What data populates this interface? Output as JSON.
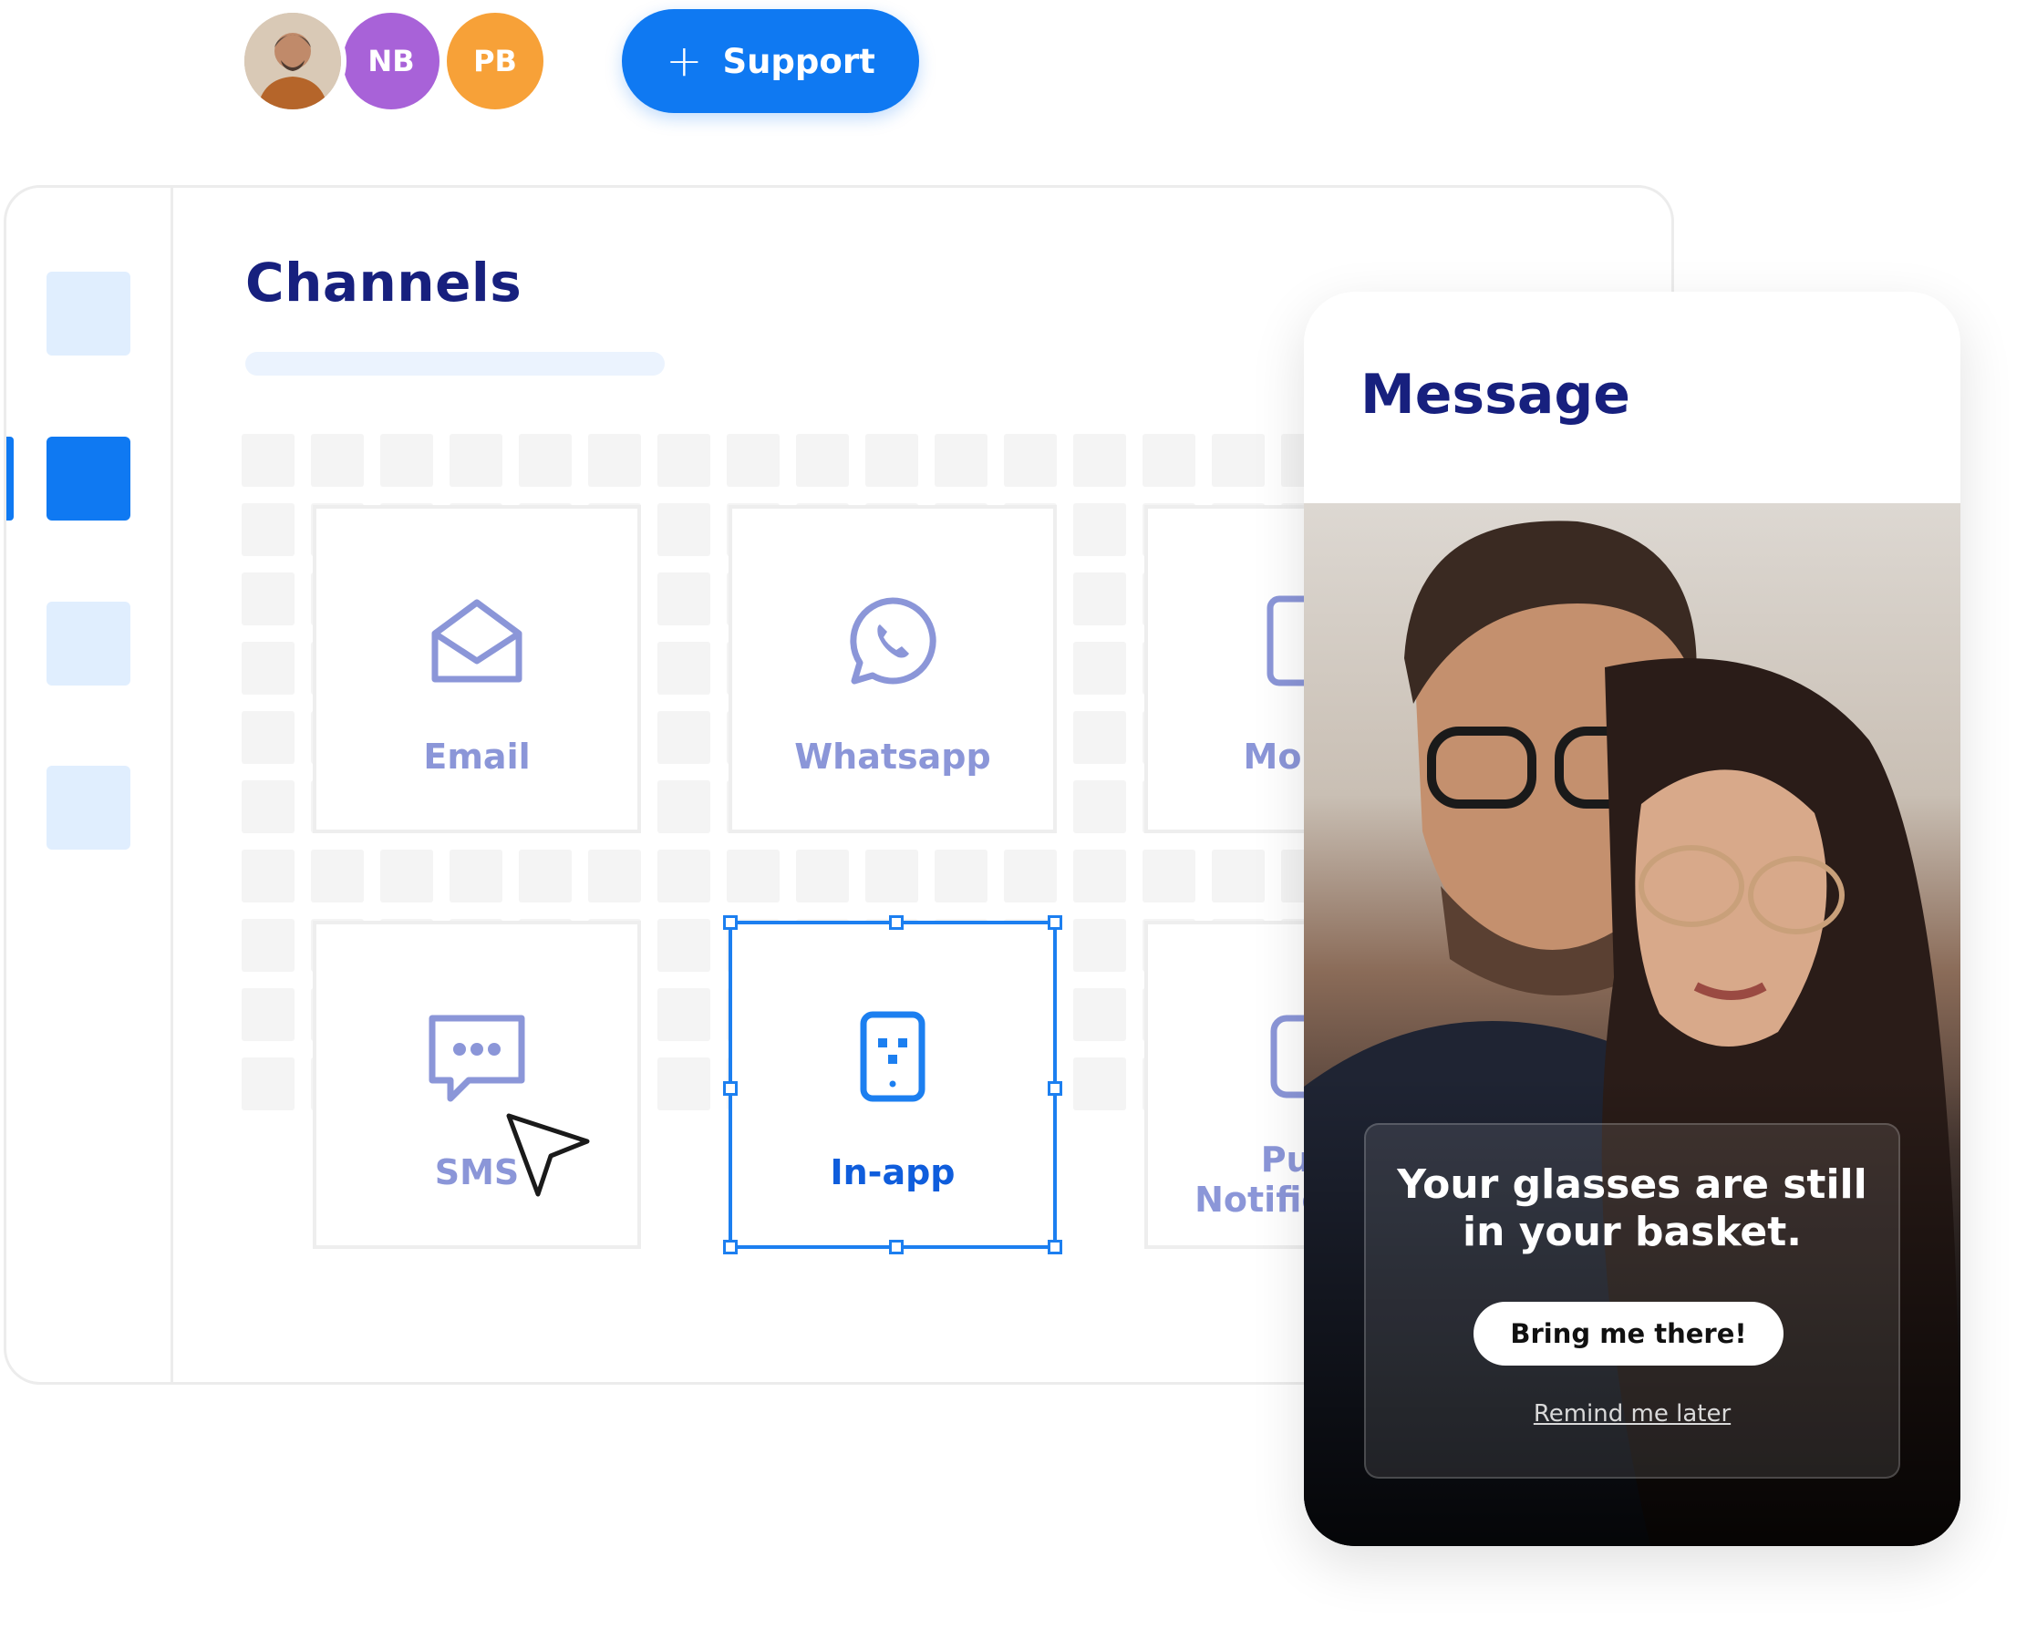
{
  "header": {
    "avatars": [
      {
        "type": "photo",
        "initials": ""
      },
      {
        "type": "initials",
        "initials": "NB",
        "color": "#a862d8"
      },
      {
        "type": "initials",
        "initials": "PB",
        "color": "#f7a138"
      }
    ],
    "support_button": {
      "label": "Support",
      "icon": "plus-icon",
      "color": "#0f79f2"
    }
  },
  "sidebar": {
    "items": [
      {
        "icon": "nav-tile",
        "active": false
      },
      {
        "icon": "nav-tile",
        "active": true
      },
      {
        "icon": "nav-tile",
        "active": false
      },
      {
        "icon": "nav-tile",
        "active": false
      }
    ]
  },
  "main": {
    "title": "Channels",
    "channels": [
      {
        "label": "Email",
        "icon": "envelope-icon",
        "selected": false
      },
      {
        "label": "Whatsapp",
        "icon": "whatsapp-icon",
        "selected": false
      },
      {
        "label": "Mobile",
        "icon": "tablet-icon",
        "selected": false
      },
      {
        "label": "SMS",
        "icon": "chat-bubble-icon",
        "selected": false
      },
      {
        "label": "In-app",
        "icon": "in-app-icon",
        "selected": true
      },
      {
        "label": "Push Notification",
        "icon": "push-icon",
        "selected": false
      }
    ]
  },
  "phone": {
    "title": "Message",
    "overlay": {
      "heading_line1": "Your glasses are still",
      "heading_line2": "in your basket.",
      "button_label": "Bring me there!",
      "secondary_link": "Remind me later"
    }
  },
  "colors": {
    "accent": "#0f79f2",
    "title_navy": "#17207e",
    "channel_label": "#8b96d8"
  }
}
